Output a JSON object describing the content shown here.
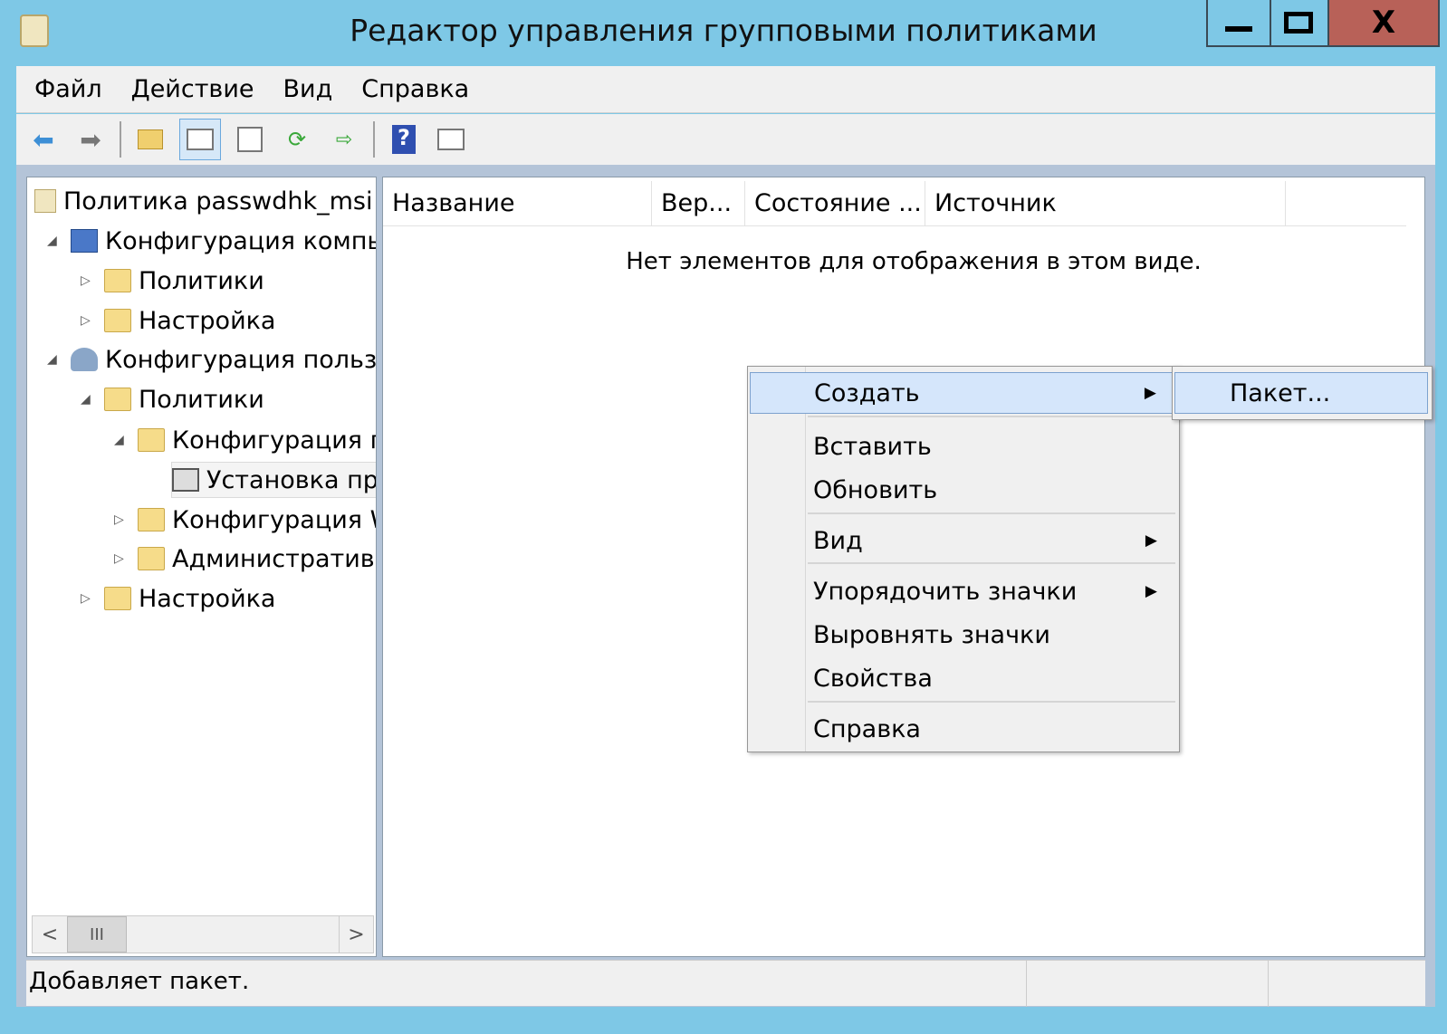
{
  "window": {
    "title": "Редактор управления групповыми политиками",
    "minimize": "—",
    "maximize": "□",
    "close": "X"
  },
  "menu": [
    "Файл",
    "Действие",
    "Вид",
    "Справка"
  ],
  "toolbar": [
    "back-icon",
    "forward-icon",
    "up-folder-icon",
    "show-hide-tree-icon",
    "properties-icon",
    "refresh-icon",
    "export-list-icon",
    "help-icon",
    "show-action-pane-icon"
  ],
  "tree": [
    {
      "label": "Политика passwdhk_msi",
      "level": 0,
      "exp": "",
      "icon": "policy"
    },
    {
      "label": "Конфигурация компьютера",
      "level": 1,
      "exp": "◢",
      "icon": "computer"
    },
    {
      "label": "Политики",
      "level": 2,
      "exp": "▷",
      "icon": "folder"
    },
    {
      "label": "Настройка",
      "level": 2,
      "exp": "▷",
      "icon": "folder"
    },
    {
      "label": "Конфигурация пользователя",
      "level": 1,
      "exp": "◢",
      "icon": "user"
    },
    {
      "label": "Политики",
      "level": 2,
      "exp": "◢",
      "icon": "folder"
    },
    {
      "label": "Конфигурация программ",
      "level": 3,
      "exp": "◢",
      "icon": "folder"
    },
    {
      "label": "Установка программ",
      "level": 4,
      "exp": "",
      "icon": "install",
      "selected": true
    },
    {
      "label": "Конфигурация Windows",
      "level": 3,
      "exp": "▷",
      "icon": "folder"
    },
    {
      "label": "Административные шаблоны",
      "level": 3,
      "exp": "▷",
      "icon": "folder"
    },
    {
      "label": "Настройка",
      "level": 2,
      "exp": "▷",
      "icon": "folder"
    }
  ],
  "columns": [
    "Название",
    "Вер...",
    "Состояние ...",
    "Источник"
  ],
  "empty_message": "Нет элементов для отображения в этом виде.",
  "scroll": {
    "left": "<",
    "thumb": "III",
    "right": ">"
  },
  "status": "Добавляет пакет.",
  "context_menu": {
    "create": "Создать",
    "paste": "Вставить",
    "refresh": "Обновить",
    "view": "Вид",
    "arrange": "Упорядочить значки",
    "align": "Выровнять значки",
    "properties": "Свойства",
    "help": "Справка"
  },
  "submenu": {
    "package": "Пакет..."
  }
}
